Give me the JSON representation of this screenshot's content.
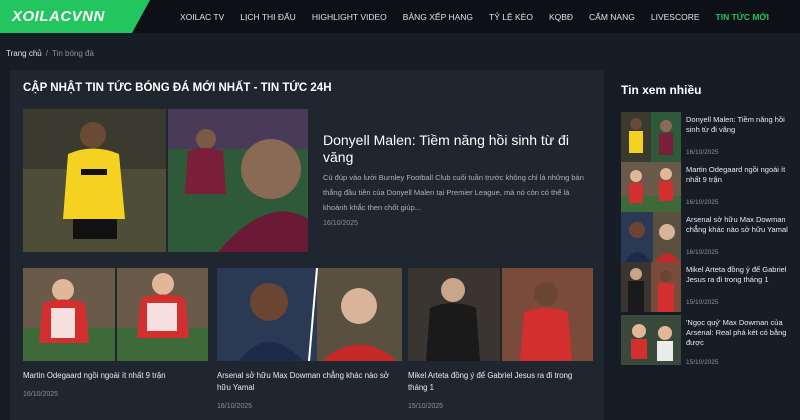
{
  "brand": {
    "logo_text": "XOILACVNN",
    "accent": "#22c55e"
  },
  "nav": {
    "items": [
      {
        "label": "XOILAC TV"
      },
      {
        "label": "LỊCH THI ĐẤU"
      },
      {
        "label": "HIGHLIGHT VIDEO"
      },
      {
        "label": "BẢNG XẾP HẠNG"
      },
      {
        "label": "TỶ LỆ KÈO"
      },
      {
        "label": "KQBĐ"
      },
      {
        "label": "CẨM NANG"
      },
      {
        "label": "LIVESCORE"
      },
      {
        "label": "TIN TỨC MỚI"
      }
    ],
    "active_index": 8
  },
  "breadcrumb": {
    "home": "Trang chủ",
    "separator": "/",
    "current": "Tin bóng đá"
  },
  "main": {
    "section_title": "CẬP NHẬT TIN TỨC BÓNG ĐÁ MỚI NHẤT - TIN TỨC 24H",
    "featured": {
      "title": "Donyell Malen: Tiềm năng hồi sinh từ đi văng",
      "description": "Cú đúp vào lưới Burnley Football Club cuối tuần trước không chỉ là những bàn thắng đầu tiên của Donyell Malen tại Premier League, mà nó còn có thể là khoảnh khắc then chốt giúp...",
      "date": "16/10/2025"
    },
    "articles": [
      {
        "title": "Martin Odegaard ngồi ngoài ít nhất 9 trận",
        "date": "16/10/2025"
      },
      {
        "title": "Arsenal sở hữu Max Dowman chẳng khác nào sở hữu Yamal",
        "date": "16/10/2025"
      },
      {
        "title": "Mikel Arteta đồng ý để Gabriel Jesus ra đi trong tháng 1",
        "date": "15/10/2025"
      }
    ]
  },
  "sidebar": {
    "title": "Tin xem nhiều",
    "items": [
      {
        "title": "Donyell Malen: Tiềm năng hồi sinh từ đi văng",
        "date": "16/10/2025"
      },
      {
        "title": "Martin Odegaard ngồi ngoài ít nhất 9 trận",
        "date": "16/10/2025"
      },
      {
        "title": "Arsenal sở hữu Max Dowman chẳng khác nào sở hữu Yamal",
        "date": "16/10/2025"
      },
      {
        "title": "Mikel Arteta đồng ý để Gabriel Jesus ra đi trong tháng 1",
        "date": "15/10/2025"
      },
      {
        "title": "'Ngọc quý' Max Dowman của Arsenal: Real phá két có bằng được",
        "date": "15/10/2025"
      }
    ]
  }
}
